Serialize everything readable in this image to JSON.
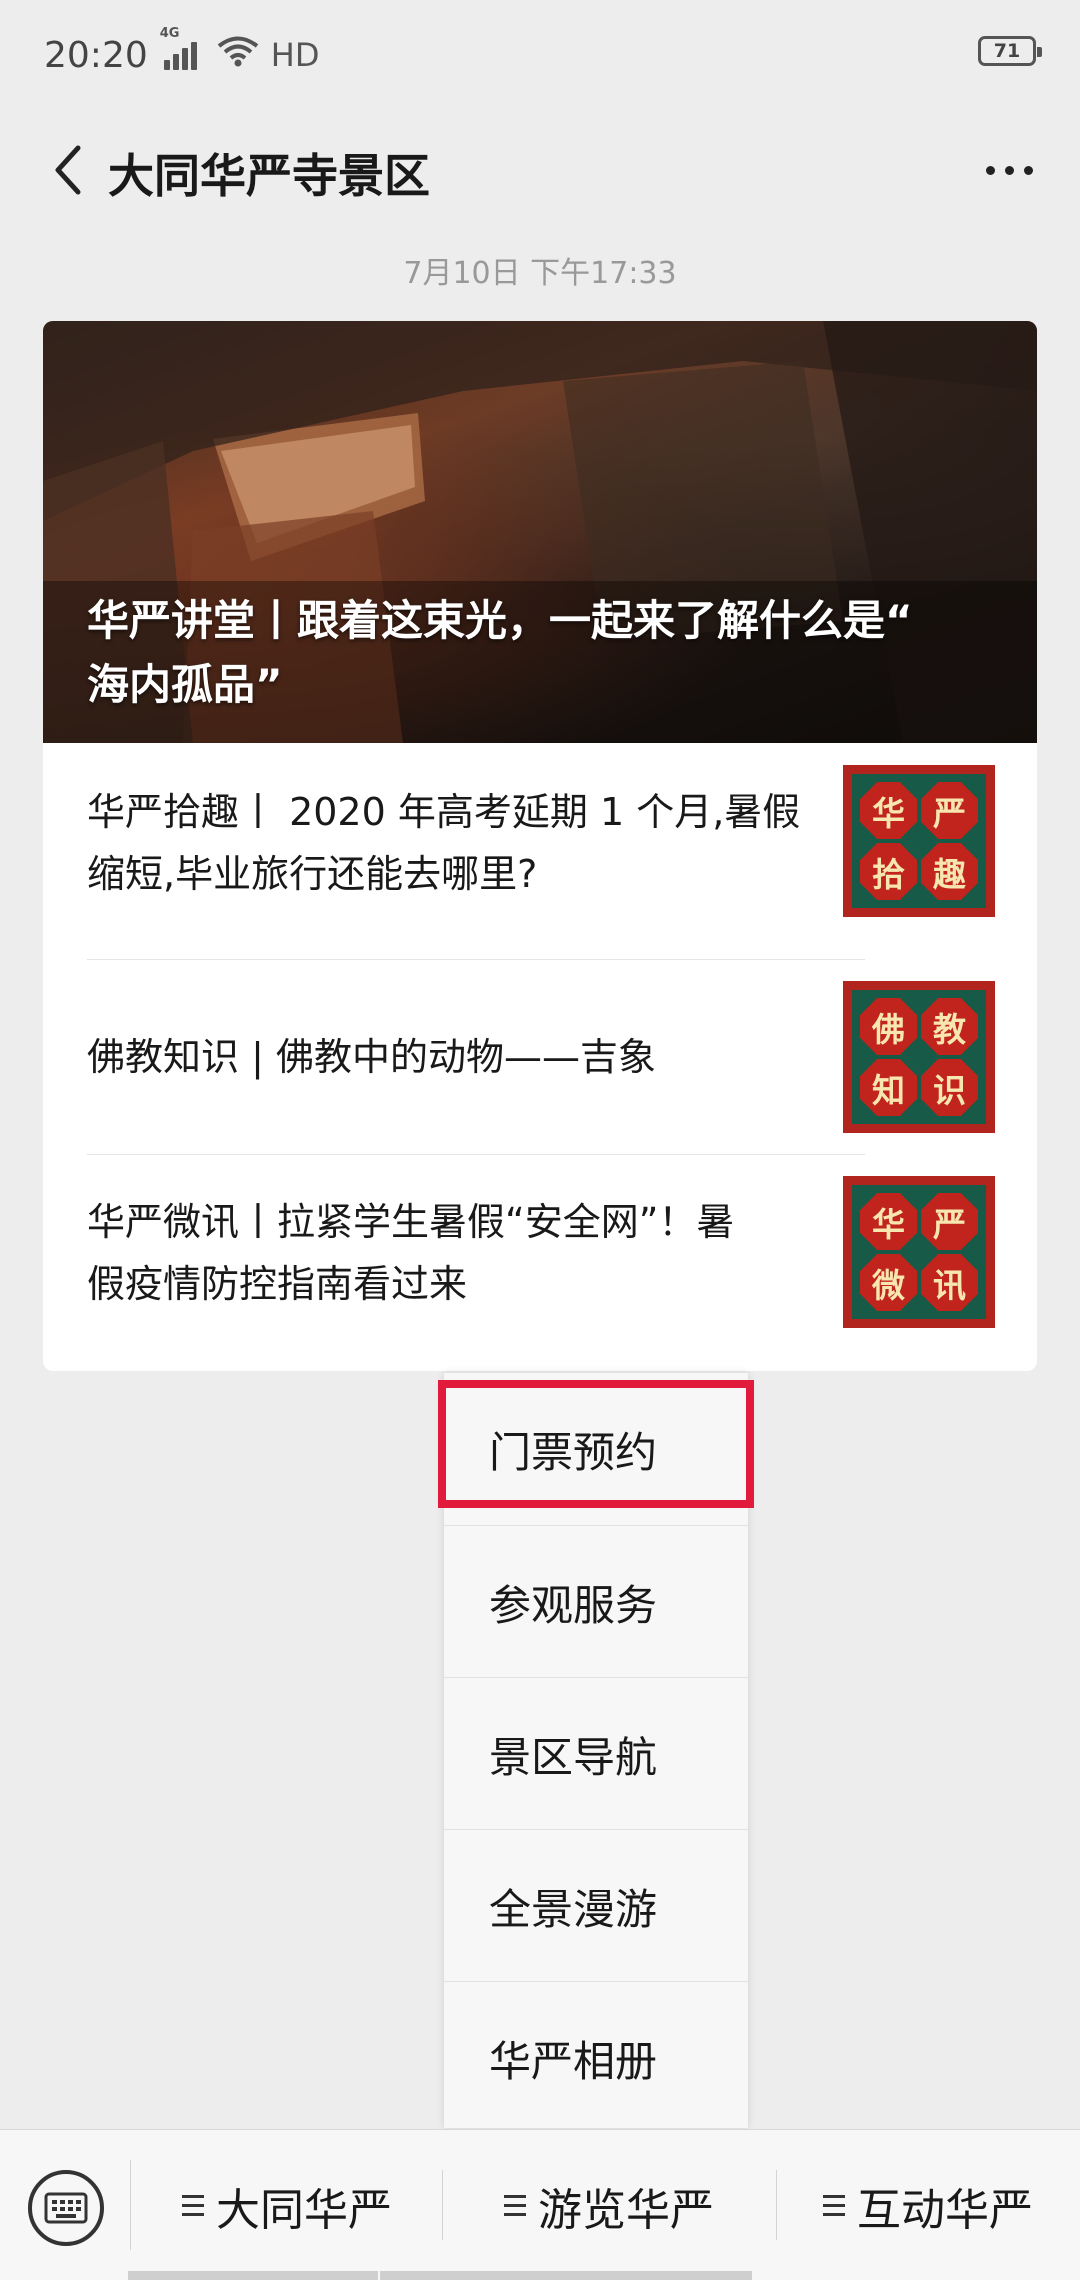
{
  "status_bar": {
    "time": "20:20",
    "network": "4G",
    "hd_label": "HD",
    "battery": "71"
  },
  "nav": {
    "title": "大同华严寺景区"
  },
  "timestamp": "7月10日 下午17:33",
  "card": {
    "cover_title_line1": "华严讲堂丨跟着这束光，一起来了解什么是“",
    "cover_title_line2": "海内孤品”",
    "articles": [
      {
        "title_line1": "华严拾趣丨 2020 年高考延期 1 个月,暑假",
        "title_line2": "缩短,毕业旅行还能去哪里?",
        "thumb_chars": [
          "华",
          "严",
          "拾",
          "趣"
        ]
      },
      {
        "title_line1": "佛教知识 | 佛教中的动物——吉象",
        "title_line2": "",
        "thumb_chars": [
          "佛",
          "教",
          "知",
          "识"
        ]
      },
      {
        "title_line1": "华严微讯丨拉紧学生暑假“安全网”！暑",
        "title_line2": "假疫情防控指南看过来",
        "thumb_chars": [
          "华",
          "严",
          "微",
          "讯"
        ]
      }
    ]
  },
  "popup_menu": {
    "items": [
      "门票预约",
      "参观服务",
      "景区导航",
      "全景漫游",
      "华严相册"
    ],
    "highlighted_index": 0
  },
  "bottom_menu": {
    "tabs": [
      "大同华严",
      "游览华严",
      "互动华严"
    ],
    "highlighted_index": 1
  },
  "colors": {
    "highlight": "#e21a3b",
    "background": "#ededed",
    "thumb_red": "#b2251e",
    "thumb_green": "#175a47"
  }
}
